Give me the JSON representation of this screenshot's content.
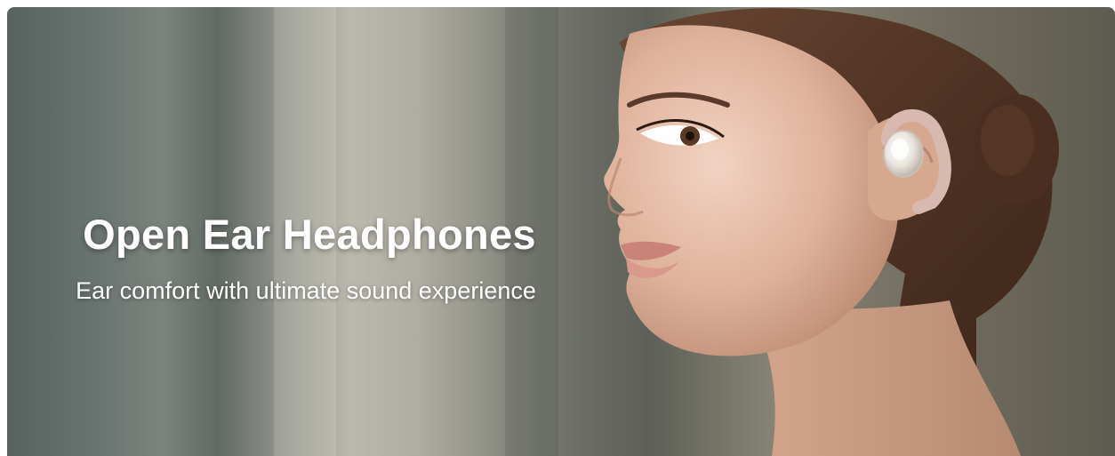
{
  "banner": {
    "headline": "Open Ear Headphones",
    "subheadline": "Ear comfort with ultimate sound experience",
    "image_subject": "woman-profile-wearing-open-ear-earbud"
  }
}
